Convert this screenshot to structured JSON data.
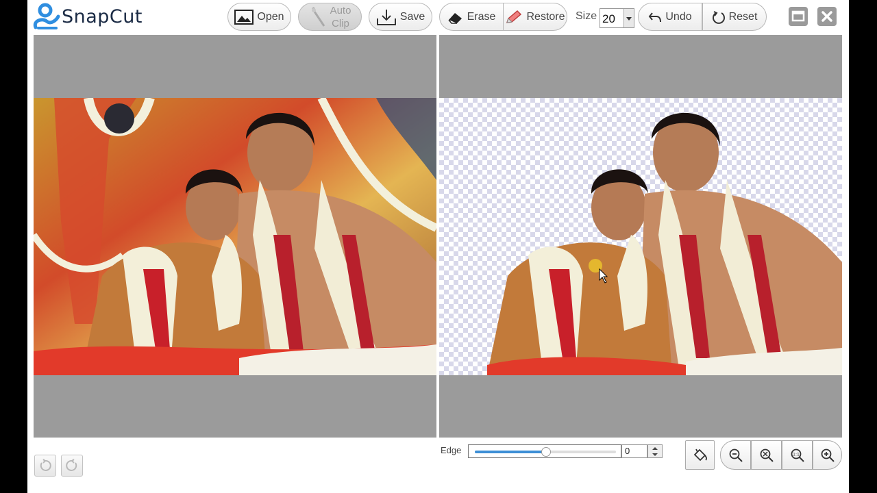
{
  "app": {
    "name": "SnapCut"
  },
  "toolbar": {
    "open_label": "Open",
    "auto_clip_line1": "Auto",
    "auto_clip_line2": "Clip",
    "save_label": "Save",
    "erase_label": "Erase",
    "restore_label": "Restore",
    "size_label": "Size",
    "size_value": "20",
    "undo_label": "Undo",
    "reset_label": "Reset"
  },
  "edge": {
    "label": "Edge",
    "value": "0",
    "slider_fraction": 0.5
  },
  "icons": {
    "open": "image-icon",
    "auto_clip": "magic-wand-icon",
    "save": "download-icon",
    "erase": "eraser-icon",
    "restore": "pencil-icon",
    "undo": "undo-arrow-icon",
    "reset": "reset-circle-icon",
    "paint": "paint-bucket-icon",
    "zoom_out": "zoom-out-icon",
    "zoom_fit": "zoom-fit-icon",
    "zoom_actual": "zoom-actual-size-icon",
    "zoom_in": "zoom-in-icon"
  },
  "colors": {
    "brand_blue": "#2f8ee0",
    "logo_text": "#1b2b45",
    "canvas_bg": "#9b9b9b",
    "slider_fill": "#3d8fd6"
  }
}
